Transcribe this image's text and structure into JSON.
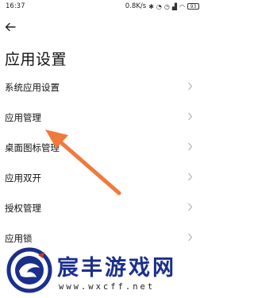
{
  "status_bar": {
    "time": "16:37",
    "network_speed": "0.8K/s",
    "battery": "93",
    "icons": [
      "bluetooth-icon",
      "mute-icon",
      "alarm-icon",
      "signal-icon",
      "wifi-icon",
      "battery-icon"
    ]
  },
  "header": {
    "back_icon": "arrow-left-icon",
    "title": "应用设置"
  },
  "settings_list": {
    "items": [
      {
        "label": "系统应用设置"
      },
      {
        "label": "应用管理"
      },
      {
        "label": "桌面图标管理"
      },
      {
        "label": "应用双开"
      },
      {
        "label": "授权管理"
      },
      {
        "label": "应用锁"
      }
    ]
  },
  "annotation": {
    "arrow_color": "#f07a3c"
  },
  "watermark": {
    "name": "宸丰游戏网",
    "url": "www.wxcff.net",
    "brand_color": "#1a2f8c"
  }
}
